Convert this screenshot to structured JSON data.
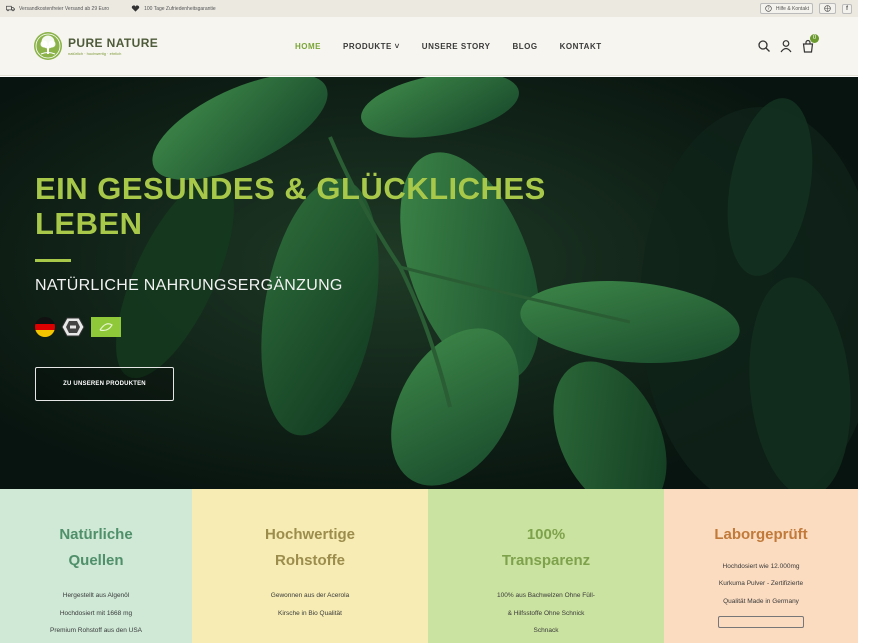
{
  "topbar": {
    "left_items": [
      {
        "icon": "truck-icon",
        "text": "Versandkostenfreier Versand ab 29 Euro"
      },
      {
        "icon": "heart-icon",
        "text": "100 Tage Zufriedenheitsgarantie"
      }
    ],
    "help_label": "Hilfe & Kontakt",
    "lang_label": "DE"
  },
  "header": {
    "logo_name": "PURE NATURE",
    "logo_tagline": "natürlich · hochwertig · ehrlich",
    "nav": [
      {
        "label": "HOME",
        "active": true
      },
      {
        "label": "PRODUKTE ˅",
        "active": false
      },
      {
        "label": "UNSERE STORY",
        "active": false
      },
      {
        "label": "BLOG",
        "active": false
      },
      {
        "label": "KONTAKT",
        "active": false
      }
    ],
    "cart_count": "0",
    "icons": [
      "search-icon",
      "user-icon",
      "cart-icon"
    ]
  },
  "hero": {
    "title": "EIN GESUNDES & GLÜCKLICHES LEBEN",
    "subtitle": "NATÜRLICHE NAHRUNGSERGÄNZUNG",
    "badges": [
      "germany-flag-icon",
      "bio-seal-icon",
      "eu-organic-icon"
    ],
    "cta_label": "ZU UNSEREN PRODUKTEN"
  },
  "features": [
    {
      "title_line1": "Natürliche",
      "title_line2": "Quellen",
      "lines": [
        "Hergestellt aus Algenöl",
        "Hochdosiert mit 1668 mg",
        "Premium Rohstoff aus den USA"
      ],
      "bg": "#cfe9d6",
      "color": "#4f8f69"
    },
    {
      "title_line1": "Hochwertige",
      "title_line2": "Rohstoffe",
      "lines": [
        "Gewonnen aus der Acerola",
        "Kirsche in Bio Qualität"
      ],
      "bg": "#f6ecb4",
      "color": "#9c8d4c"
    },
    {
      "title_line1": "100%",
      "title_line2": "Transparenz",
      "lines": [
        "100% aus Bachwelzen Ohne Füll-",
        "& Hilfsstoffe Ohne Schnick",
        "Schnack"
      ],
      "bg": "#cbe3a0",
      "color": "#7ea24c"
    },
    {
      "title_line1": "Laborgeprüft",
      "title_line2": "",
      "lines": [
        "Hochdosiert wie 12.000mg",
        "Kurkuma Pulver - Zertifizierte",
        "Qualität Made in Germany"
      ],
      "bg": "#fbdcc0",
      "color": "#c17a3a"
    }
  ],
  "colors": {
    "accent_green": "#7aa43a",
    "hero_title": "#a8c84a",
    "header_bg": "#f7f5ef"
  }
}
